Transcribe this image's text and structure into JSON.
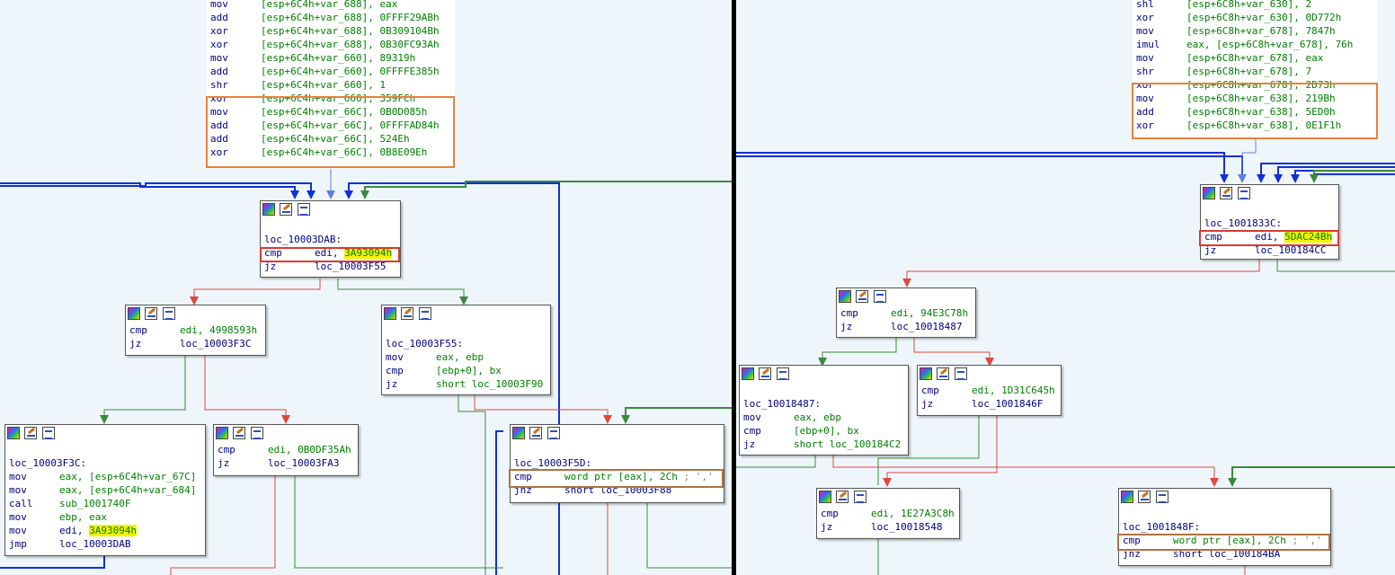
{
  "left": {
    "top_block": {
      "lines": [
        {
          "m": "mov",
          "a": "[esp+6C4h+var_688], eax"
        },
        {
          "m": "add",
          "a": "[esp+6C4h+var_688], 0FFFF29ABh"
        },
        {
          "m": "xor",
          "a": "[esp+6C4h+var_688], 0B309104Bh"
        },
        {
          "m": "xor",
          "a": "[esp+6C4h+var_688], 0B30FC93Ah"
        },
        {
          "m": "mov",
          "a": "[esp+6C4h+var_660], 89319h"
        },
        {
          "m": "add",
          "a": "[esp+6C4h+var_660], 0FFFFE385h"
        },
        {
          "m": "shr",
          "a": "[esp+6C4h+var_660], 1"
        },
        {
          "m": "xor",
          "a": "[esp+6C4h+var_660], 359FCh"
        },
        {
          "m": "mov",
          "a": "[esp+6C4h+var_66C], 0B0D085h"
        },
        {
          "m": "add",
          "a": "[esp+6C4h+var_66C], 0FFFFAD84h"
        },
        {
          "m": "add",
          "a": "[esp+6C4h+var_66C], 524Eh"
        },
        {
          "m": "xor",
          "a": "[esp+6C4h+var_66C], 0B8E09Eh"
        }
      ]
    },
    "node_dab": {
      "label": "loc_10003DAB:",
      "cmp_m": "cmp",
      "cmp_a": "edi, ",
      "cmp_imm": "3A93094h",
      "jz_m": "jz",
      "jz_a": "loc_10003F55"
    },
    "node_4998": {
      "cmp_m": "cmp",
      "cmp_a": "edi, 4998593h",
      "jz_m": "jz",
      "jz_a": "loc_10003F3C"
    },
    "node_f55": {
      "label": "loc_10003F55:",
      "lines": [
        {
          "m": "mov",
          "a": "eax, ebp"
        },
        {
          "m": "cmp",
          "a": "[ebp+0], bx"
        },
        {
          "m": "jz",
          "a": "short loc_10003F90"
        }
      ]
    },
    "node_f3c": {
      "label": "loc_10003F3C:",
      "lines": [
        {
          "m": "mov",
          "a": "eax, [esp+6C4h+var_67C]"
        },
        {
          "m": "mov",
          "a": "eax, [esp+6C4h+var_684]"
        },
        {
          "m": "call",
          "a": "sub_1001740F"
        },
        {
          "m": "mov",
          "a": "ebp, eax"
        }
      ],
      "mov_m": "mov",
      "mov_a": "edi, ",
      "mov_imm": "3A93094h",
      "jmp_m": "jmp",
      "jmp_a": "loc_10003DAB"
    },
    "node_b0d": {
      "cmp_m": "cmp",
      "cmp_a": "edi, 0B0DF35Ah",
      "jz_m": "jz",
      "jz_a": "loc_10003FA3"
    },
    "node_f5d": {
      "label": "loc_10003F5D:",
      "cmp_m": "cmp",
      "cmp_a": "word ptr [eax], 2Ch",
      "cmp_cmt": " ; ','",
      "jnz_m": "jnz",
      "jnz_a": "short loc_10003F88"
    }
  },
  "right": {
    "top_block": {
      "lines": [
        {
          "m": "shl",
          "a": "[esp+6C8h+var_630], 2"
        },
        {
          "m": "xor",
          "a": "[esp+6C8h+var_630], 0D772h"
        },
        {
          "m": "mov",
          "a": "[esp+6C8h+var_678], 7847h"
        },
        {
          "m": "imul",
          "a": "eax, [esp+6C8h+var_678], 76h"
        },
        {
          "m": "mov",
          "a": "[esp+6C8h+var_678], eax"
        },
        {
          "m": "shr",
          "a": "[esp+6C8h+var_678], 7"
        },
        {
          "m": "xor",
          "a": "[esp+6C8h+var_678], 2D73h"
        },
        {
          "m": "mov",
          "a": "[esp+6C8h+var_638], 219Bh"
        },
        {
          "m": "add",
          "a": "[esp+6C8h+var_638], 5ED0h"
        },
        {
          "m": "xor",
          "a": "[esp+6C8h+var_638], 0E1F1h"
        }
      ]
    },
    "node_833c": {
      "label": "loc_1001833C:",
      "cmp_m": "cmp",
      "cmp_a": "edi, ",
      "cmp_imm": "5DAC24Bh",
      "jz_m": "jz",
      "jz_a": "loc_100184CC"
    },
    "node_94e": {
      "cmp_m": "cmp",
      "cmp_a": "edi, 94E3C78h",
      "jz_m": "jz",
      "jz_a": "loc_10018487"
    },
    "node_8487": {
      "label": "loc_10018487:",
      "lines": [
        {
          "m": "mov",
          "a": "eax, ebp"
        },
        {
          "m": "cmp",
          "a": "[ebp+0], bx"
        },
        {
          "m": "jz",
          "a": "short loc_100184C2"
        }
      ]
    },
    "node_1d3": {
      "cmp_m": "cmp",
      "cmp_a": "edi, 1D31C645h",
      "jz_m": "jz",
      "jz_a": "loc_1001846F"
    },
    "node_1e2": {
      "cmp_m": "cmp",
      "cmp_a": "edi, 1E27A3C8h",
      "jz_m": "jz",
      "jz_a": "loc_10018548"
    },
    "node_848f": {
      "label": "loc_1001848F:",
      "cmp_m": "cmp",
      "cmp_a": "word ptr [eax], 2Ch",
      "cmp_cmt": " ; ','",
      "jnz_m": "jnz",
      "jnz_a": "short loc_100184BA"
    }
  },
  "colors": {
    "edge_blue": "#1030d8",
    "edge_green": "#3a8a3a",
    "edge_red": "#e0483c",
    "highlight": "#f4f400",
    "box_orange": "#e8813a",
    "box_red": "#d83b30"
  },
  "icons": [
    "graph-color-icon",
    "edit-pencil-icon",
    "xref-list-icon"
  ]
}
